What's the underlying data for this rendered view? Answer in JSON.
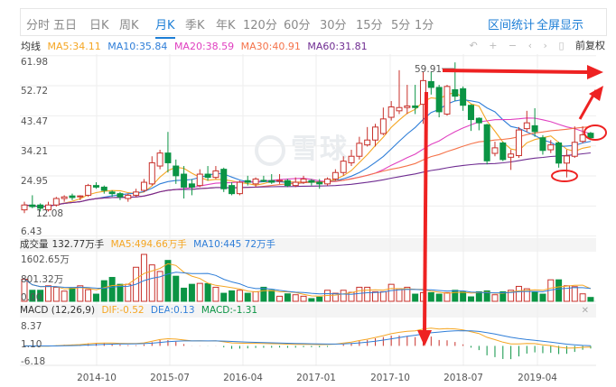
{
  "tabs": [
    "分时",
    "五日",
    "日K",
    "周K",
    "月K",
    "季K",
    "年K",
    "120分",
    "60分",
    "30分",
    "15分",
    "5分",
    "1分"
  ],
  "active_tab": 4,
  "links": {
    "range_stats": "区间统计",
    "fullscreen": "全屏显示"
  },
  "legend": {
    "label": "均线",
    "items": [
      {
        "text": "MA5:34.11",
        "color": "#f5a623"
      },
      {
        "text": "MA10:35.84",
        "color": "#2f7ed8"
      },
      {
        "text": "MA20:38.59",
        "color": "#e040c0"
      },
      {
        "text": "MA30:40.91",
        "color": "#f5734a"
      },
      {
        "text": "MA60:31.81",
        "color": "#6f2c91"
      }
    ]
  },
  "toolbar": {
    "icons": [
      "undo-icon",
      "zoom-in-icon",
      "zoom-out-icon",
      "pan-left-icon",
      "pan-right-icon",
      "bookmark-icon"
    ],
    "adjust_label": "前复权"
  },
  "watermark": "雪球",
  "colors": {
    "up": "#c8312b",
    "down": "#0b9444",
    "arrow": "#ee2222"
  },
  "chart_data": {
    "type": "candlestick",
    "period": "monthly",
    "x_start": "2014-01",
    "y_labels": [
      "61.98",
      "52.72",
      "43.47",
      "34.21",
      "24.95",
      "6.43"
    ],
    "ylim": [
      6.43,
      61.98
    ],
    "x_labels": [
      "2014-10",
      "2015-07",
      "2016-04",
      "2017-01",
      "2017-10",
      "2018-07",
      "2019-04"
    ],
    "high_label": "59.91",
    "low_label": "12.08",
    "candles_ochl": [
      [
        14.5,
        16,
        17,
        13.5
      ],
      [
        16,
        15.5,
        19,
        15
      ],
      [
        16,
        15,
        16.5,
        14
      ],
      [
        14.5,
        16,
        17,
        14
      ],
      [
        16,
        18,
        18.5,
        15.5
      ],
      [
        18,
        18.5,
        19,
        17
      ],
      [
        18.8,
        18.3,
        19.5,
        17.5
      ],
      [
        18.5,
        18.8,
        19,
        17.5
      ],
      [
        19,
        22,
        22.5,
        18.5
      ],
      [
        22,
        21.5,
        23,
        21
      ],
      [
        21.5,
        20.5,
        22,
        19.5
      ],
      [
        20,
        19.5,
        20.5,
        18.5
      ],
      [
        19.5,
        18.5,
        20,
        17.5
      ],
      [
        18,
        19,
        19.5,
        17
      ],
      [
        19,
        20,
        21,
        18.5
      ],
      [
        20.5,
        23,
        24,
        20
      ],
      [
        22.5,
        29,
        31,
        22
      ],
      [
        28,
        32,
        33,
        27
      ],
      [
        32,
        29,
        38.5,
        26
      ],
      [
        28,
        25,
        30,
        22.5
      ],
      [
        25.5,
        21.5,
        28,
        18
      ],
      [
        22.5,
        21.5,
        24,
        19
      ],
      [
        22,
        25.5,
        27,
        21.5
      ],
      [
        25.5,
        24.5,
        28,
        23.5
      ],
      [
        24.5,
        26.5,
        28,
        24
      ],
      [
        27,
        21,
        27.5,
        20
      ],
      [
        22,
        19.5,
        23,
        19
      ],
      [
        19.5,
        23,
        23.5,
        19
      ],
      [
        23.5,
        23,
        25,
        22
      ],
      [
        22.5,
        24,
        24.5,
        21.5
      ],
      [
        23.6,
        23.4,
        25,
        23
      ],
      [
        23.5,
        23,
        25.5,
        22.5
      ],
      [
        23.4,
        23.6,
        25.5,
        22.5
      ],
      [
        23.5,
        22,
        24,
        21.5
      ],
      [
        22,
        23,
        24.5,
        21.5
      ],
      [
        23,
        24,
        25,
        22.5
      ],
      [
        23.5,
        23,
        24,
        22
      ],
      [
        23,
        22.5,
        24,
        21
      ],
      [
        22.5,
        24,
        24.5,
        22
      ],
      [
        24,
        26,
        27,
        23.5
      ],
      [
        26,
        29.5,
        31,
        25
      ],
      [
        29,
        31,
        33,
        28
      ],
      [
        31,
        35,
        37,
        30
      ],
      [
        34.5,
        36,
        40,
        34
      ],
      [
        36,
        40,
        41,
        34
      ],
      [
        38,
        42.5,
        46,
        37.5
      ],
      [
        43,
        46.2,
        48,
        42
      ],
      [
        45,
        46,
        57.5,
        44
      ],
      [
        46,
        46.5,
        53,
        44
      ],
      [
        46.5,
        46,
        53,
        44
      ],
      [
        47,
        54.3,
        57,
        41
      ],
      [
        54,
        52.2,
        57,
        50
      ],
      [
        52.2,
        44.7,
        53,
        43
      ],
      [
        44,
        52.5,
        53,
        43.5
      ],
      [
        51.5,
        49.5,
        59.91,
        48
      ],
      [
        51.8,
        46.7,
        52.5,
        45
      ],
      [
        46.7,
        42.3,
        47,
        38.8
      ],
      [
        42.7,
        41.3,
        43,
        39
      ],
      [
        40.7,
        29.6,
        41,
        28.5
      ],
      [
        31.9,
        33.6,
        35.5,
        31
      ],
      [
        35.1,
        30,
        35.5,
        29.5
      ],
      [
        30.7,
        31.7,
        33,
        26.8
      ],
      [
        31.2,
        39.1,
        40,
        30.5
      ],
      [
        39.5,
        41.3,
        45,
        38.5
      ],
      [
        40.4,
        38.6,
        45.8,
        37
      ],
      [
        36.7,
        32.8,
        37.5,
        31.5
      ],
      [
        33,
        34.5,
        36,
        32
      ],
      [
        35.1,
        28.9,
        35.5,
        27.5
      ],
      [
        28.9,
        31.1,
        33,
        24.5
      ],
      [
        31,
        35.3,
        40.2,
        30.5
      ],
      [
        35.6,
        37.6,
        40.2,
        35
      ],
      [
        38.1,
        36.7,
        38.5,
        36
      ]
    ],
    "volume_wan": [
      755,
      377,
      377,
      530,
      480,
      347,
      449,
      530,
      398,
      245,
      704,
      816,
      581,
      581,
      1163,
      1602.65,
      1244,
      1020,
      1397,
      857,
      449,
      581,
      612,
      602,
      480,
      275,
      357,
      377,
      275,
      326,
      480,
      377,
      173,
      255,
      224,
      173,
      92,
      143,
      377,
      275,
      377,
      306,
      480,
      480,
      326,
      326,
      581,
      428,
      480,
      245,
      296,
      296,
      245,
      296,
      377,
      326,
      153,
      326,
      357,
      224,
      326,
      377,
      510,
      428,
      326,
      245,
      734,
      734,
      530,
      500,
      255,
      132.77
    ],
    "ma_periods": [
      5,
      10,
      20,
      30,
      60
    ]
  },
  "volume_panel": {
    "title": "成交量",
    "value": "132.77万手",
    "ma5": "MA5:494.66万手",
    "ma10": "MA10:445.72万手",
    "y_labels": [
      "1602.65万",
      "801.32万",
      "0.00"
    ],
    "ylim": [
      0,
      1602.65
    ]
  },
  "macd_panel": {
    "title": "MACD (12,26,9)",
    "dif": "DIF:-0.52",
    "dea": "DEA:0.13",
    "macd": "MACD:-1.31",
    "y_labels": [
      "8.37",
      "1.10",
      "-6.18"
    ],
    "ylim": [
      -6.18,
      8.37
    ],
    "dif_color": "#f5a623",
    "dea_color": "#2f7ed8",
    "macd_color": "#0b9444"
  }
}
